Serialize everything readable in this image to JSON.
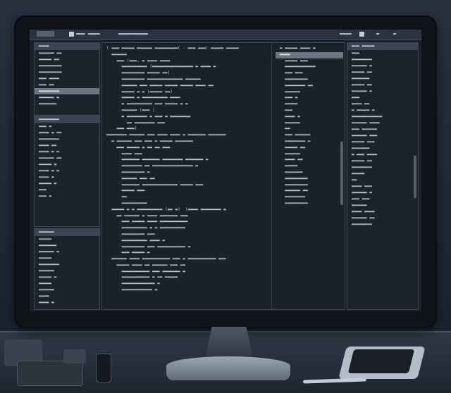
{
  "menubar": {
    "item1": "▬▬▬▬▬▬",
    "item2": "▬▬▬ ▬▬▬▬",
    "item3": "▬▬▬▬▬▬▬▬▬▬",
    "right1": "▬▬▬▬",
    "right2": "▬",
    "right3": "▬"
  },
  "left_panel": {
    "title": "▬▬▬▬",
    "items": [
      "▬▬▬▬▬▬ ▬▬",
      "▬▬▬▬▬ ▬▬",
      "▬▬▬▬▬▬▬▬▬",
      "▬▬▬▬▬▬▬▬▬",
      "▬▬▬ ▬▬▬▬",
      "▬▬▬ ▬▬",
      "▬▬▬▬▬▬▬▬",
      "▬▬▬▬▬▬ ▬",
      "▬▬▬▬▬▬▬"
    ]
  },
  "left_panel2": {
    "title": "▬▬▬▬▬▬▬▬",
    "items": [
      "▬▬▬ ▬",
      "▬▬▬▬ ▬ ▬▬",
      "▬▬▬▬▬▬▬▬",
      "▬▬▬▬ ▬▬",
      "▬▬▬▬ ▬ ▬",
      "▬▬▬▬▬▬ ▬▬",
      "▬▬▬▬▬ ▬",
      "▬▬▬▬ ▬ ▬",
      "▬▬▬▬ ▬",
      "▬▬▬▬▬ ▬",
      "▬▬▬",
      "▬▬▬ ▬"
    ]
  },
  "left_panel3": {
    "title": "▬▬▬▬▬▬",
    "items": [
      "▬▬▬▬▬",
      "▬▬▬▬▬▬▬",
      "▬▬▬▬▬▬ ▬",
      "▬▬▬▬▬",
      "▬▬▬▬▬▬▬▬",
      "▬▬▬▬▬▬",
      "▬▬▬▬▬ ▬",
      "▬▬▬▬▬",
      "▬▬▬▬▬▬",
      "▬▬▬▬",
      "▬▬▬▬ ▬"
    ]
  },
  "editor": {
    "lines": [
      "( ▬▬▬ ▬▬▬▬▬ ▬▬▬▬▬▬ ▬▬▬▬▬▬▬▬▬( - ▬▬▬ ▬▬▬) ▬▬▬▬▬ ▬▬▬▬▬",
      "  ▬▬▬▬▬▬",
      "    ▬▬▬ (▬▬▬, ▬ ▬▬▬▬ ▬▬▬▬",
      "      ▬▬▬▬▬▬▬▬▬▬ (▬▬▬▬▬▬▬▬▬▬▬▬▬▬▬▬ ▬ ▬▬▬▬ ▬",
      "      ▬▬▬▬▬▬▬▬▬ ▬▬▬▬▬ ▬▬)",
      "      ▬▬▬▬▬▬▬▬▬ ▬▬▬▬▬▬▬▬▬▬▬▬▬▬ ▬▬▬▬▬▬",
      "      ▬▬▬▬▬▬ ▬▬▬ ▬▬▬▬▬ ▬▬▬▬▬ ▬▬▬▬▬ ▬▬▬▬ ▬▬",
      "      ▬▬▬▬▬ ▬ ▬ (▬▬▬▬▬ ▬▬)",
      "      ▬▬▬▬▬ ▬ ▬▬▬▬▬▬▬▬▬▬ ▬▬▬▬",
      "      ▬ ▬▬▬▬▬▬▬▬▬▬ ▬▬▬ ▬▬▬▬▬ ▬ ▬",
      "",
      "      ▬▬▬▬▬▬ (▬▬▬ )",
      "      ▬ ▬▬▬▬▬▬▬▬ ▬ ▬▬▬ ▬ ▬▬▬▬▬▬▬▬",
      "        ▬▬ ▬▬▬▬▬▬▬▬ ▬▬▬",
      "    ▬▬▬ ▬▬▬)",
      "▬▬▬▬▬▬▬▬ ▬▬▬▬▬▬ ▬▬▬ ▬▬▬▬ ▬▬▬▬ ▬ ▬▬▬▬▬▬▬ ▬▬▬▬▬▬▬",
      "  ▬ ▬▬▬▬▬▬ ▬▬▬ ▬▬▬ ▬ ▬▬▬▬▬ ▬▬▬▬▬▬▬",
      "    ▬▬▬ ▬▬▬▬▬ ▬ ▬▬ ▬▬ ▬▬▬",
      "      ▬▬▬▬ ▬▬▬",
      "      ▬▬▬▬▬▬▬ ▬▬▬▬▬▬▬ ▬▬▬▬▬▬▬▬ ▬▬▬▬▬▬▬ ▬",
      "      ▬▬▬▬▬▬▬▬ ▬▬ ▬▬▬▬▬▬▬▬▬▬▬▬▬▬▬▬ ▬",
      "      ▬▬▬▬▬▬▬▬▬ ▬",
      "      ▬▬▬▬▬▬ ▬▬▬ ▬▬",
      "      ▬▬▬▬▬▬▬ ▬▬▬▬▬▬▬▬▬▬▬▬▬▬ ▬▬▬▬▬ ▬▬▬",
      "      ▬▬▬▬▬ ▬▬▬",
      "      ▬▬",
      "      ▬▬▬▬▬▬▬▬▬▬",
      "",
      "  ▬▬▬▬▬ ▬ ▬ ▬▬▬▬▬▬▬▬▬▬ (▬▬ ▬)  (▬▬▬▬ ▬▬▬▬▬▬▬▬ ▬",
      "    ▬▬ ▬▬▬▬▬▬ ▬ ▬▬▬▬ ▬▬▬▬▬▬▬ ▬▬▬",
      "      ▬▬▬ ▬▬▬▬▬ ▬▬▬▬ ▬▬▬▬▬▬▬▬▬▬▬",
      "      ▬▬▬▬▬▬▬▬▬▬ ▬ ▬ ▬▬▬▬▬▬▬▬▬▬",
      "      ▬▬▬▬▬▬▬▬▬ ▬▬▬",
      "      ▬▬▬▬▬▬▬▬▬▬ ▬▬▬▬ ▬",
      "      ▬▬▬▬▬▬▬▬▬ ▬▬▬ ▬▬▬▬▬▬▬▬▬▬▬ ▬",
      "      ▬▬▬ ▬▬▬▬▬ ▬",
      "",
      "  ▬▬▬▬▬▬ ▬▬▬▬ ▬▬▬▬▬▬▬▬▬▬▬ ▬▬▬ ▬ ▬▬▬▬▬▬▬▬▬▬▬ ▬▬▬",
      "    ▬▬▬▬▬ ▬▬▬▬ ▬▬ ▬▬▬▬▬▬ ▬▬▬ ▬▬",
      "      ▬▬▬▬▬▬▬▬▬▬▬ ▬▬▬ ▬▬▬▬▬▬▬ ▬",
      "      ▬▬▬▬▬▬▬▬▬▬▬ ▬ ▬▬ ▬▬▬▬▬",
      "      ▬▬▬▬▬▬▬▬▬▬▬▬▬ ▬",
      "      ▬▬▬▬▬▬▬▬▬▬▬▬ ▬"
    ]
  },
  "right_code": {
    "lines": [
      "▬ ▬▬▬▬▬ ▬▬▬▬ ▬",
      "▬▬▬▬",
      "  ▬▬▬▬▬ ▬▬▬",
      "  ▬▬▬▬▬▬▬▬▬▬▬▬",
      "  ▬▬▬ ▬▬▬",
      "  ▬▬▬▬▬▬▬▬▬",
      "  ▬▬▬▬▬▬▬▬ ▬▬",
      "  ▬▬▬▬▬▬",
      "  ▬▬▬ ▬",
      "  ▬▬▬▬▬",
      "  ▬▬▬",
      "  ▬▬▬▬ ▬",
      "  ▬▬▬▬▬▬",
      "  ▬▬",
      "  ▬▬▬ ▬▬▬▬▬▬",
      "",
      "  ▬▬▬▬▬▬▬▬ ▬",
      "  ▬▬▬▬▬ ▬▬",
      "  ▬▬▬▬▬▬",
      "  ▬▬▬▬ ▬▬",
      "  ▬▬▬▬▬",
      "",
      "  ▬▬▬▬▬▬▬",
      "  ▬▬▬▬▬▬▬▬▬",
      "  ▬▬▬▬▬▬▬▬▬",
      "  ▬▬▬▬▬▬ ▬▬",
      "  ▬▬▬▬▬▬▬▬",
      "  ▬▬▬▬▬▬▬▬▬"
    ]
  },
  "right_panel": {
    "title": "▬▬▬ ▬▬▬▬▬",
    "lines": [
      "▬▬▬",
      "▬▬▬▬▬▬▬▬",
      "▬▬▬▬▬▬ ▬",
      "▬▬▬▬▬ ▬▬",
      "▬▬▬▬▬▬▬",
      "▬▬▬▬▬ ▬▬",
      "▬▬▬▬▬▬ ▬",
      "▬▬▬",
      "▬▬▬▬ ▬▬",
      "",
      "▬ ▬▬▬▬▬ ▬",
      "▬▬▬▬▬▬▬▬▬▬▬▬",
      "",
      "▬▬▬▬▬▬ ▬▬▬▬",
      "▬▬▬ ▬▬▬▬▬▬",
      "▬▬▬▬▬▬ ▬▬▬",
      "▬▬▬▬▬ ▬▬▬",
      "",
      "▬▬▬▬▬▬▬",
      "▬ ▬▬▬ ▬▬▬▬",
      "▬▬▬▬▬ ▬▬",
      "▬▬▬▬▬▬▬▬",
      "",
      "▬▬▬▬▬",
      "▬▬",
      "▬▬▬▬ ▬▬▬",
      "▬▬▬▬▬▬ ▬",
      "▬▬▬ ▬▬▬",
      "▬▬▬▬▬▬",
      "▬▬▬▬ ▬▬▬▬",
      "▬▬▬▬▬▬ ▬▬",
      "▬▬▬▬▬▬▬▬"
    ]
  }
}
